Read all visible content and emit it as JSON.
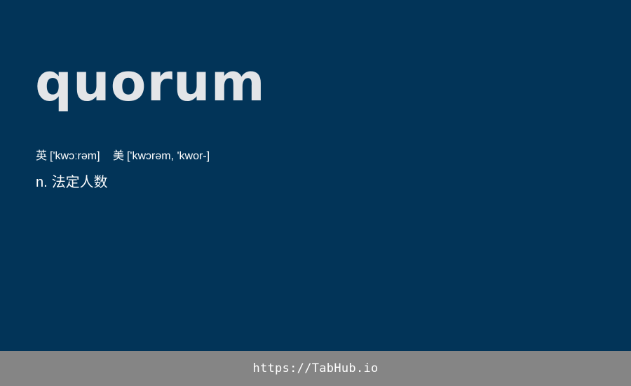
{
  "entry": {
    "word": "quorum",
    "phonetics": [
      {
        "label": "英",
        "ipa": "['kwɔːrəm]"
      },
      {
        "label": "美",
        "ipa": "['kwɔrəm, 'kwor-]"
      }
    ],
    "definition": {
      "pos": "n.",
      "meaning": "法定人数"
    }
  },
  "footer": {
    "url": "https://TabHub.io"
  },
  "colors": {
    "background": "#023458",
    "word": "#e3e5e8",
    "text": "#ffffff",
    "footer_bg": "#858585"
  }
}
